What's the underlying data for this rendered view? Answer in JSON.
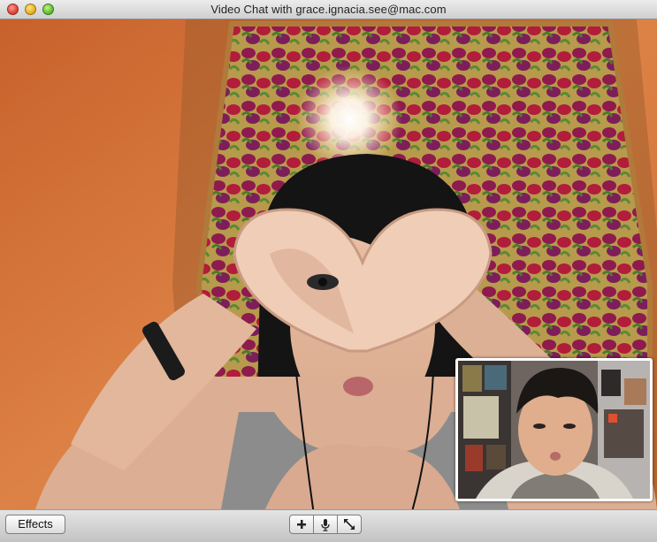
{
  "window": {
    "title": "Video Chat with grace.ignacia.see@mac.com"
  },
  "titlebar_buttons": [
    "close",
    "minimize",
    "zoom"
  ],
  "toolbar": {
    "effects_label": "Effects",
    "controls": [
      {
        "name": "add-participant",
        "icon": "plus-icon"
      },
      {
        "name": "mute-microphone",
        "icon": "microphone-icon"
      },
      {
        "name": "fullscreen",
        "icon": "expand-arrows-icon"
      }
    ]
  },
  "video": {
    "main_feed": "remote participant video",
    "self_view": "local camera preview"
  },
  "colors": {
    "wall": "#d77a3e",
    "titlebar": "#dcdcdc",
    "pip_border": "#ffffff"
  }
}
